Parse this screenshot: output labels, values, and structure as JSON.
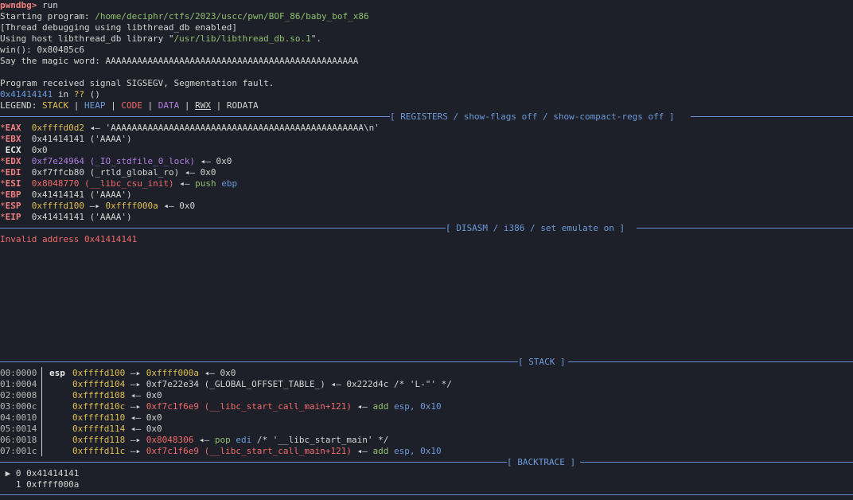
{
  "header": {
    "prompt": "pwndbg>",
    "command": " run",
    "starting_label": "Starting program: ",
    "program_path": "/home/deciphr/ctfs/2023/uscc/pwn/BOF_86/baby_bof_x86",
    "thread_debug": "[Thread debugging using libthread_db enabled]",
    "libthread_label": "Using host libthread_db library \"",
    "libthread_path": "/usr/lib/libthread_db.so.1",
    "libthread_end": "\".",
    "win_line": "win(): 0x80485c6",
    "magic_line": "Say the magic word: AAAAAAAAAAAAAAAAAAAAAAAAAAAAAAAAAAAAAAAAAAAAAAAA",
    "signal_line": "Program received signal SIGSEGV, Segmentation fault.",
    "fault_addr": "0x41414141",
    "fault_in": " in ",
    "fault_q": "??",
    "fault_paren": " ()"
  },
  "legend": {
    "label": "LEGEND: ",
    "stack": "STACK",
    "heap": "HEAP",
    "code": "CODE",
    "data": "DATA",
    "rwx": "RWX",
    "rodata": "RODATA",
    "pipe": " | "
  },
  "sections": {
    "registers": "[ REGISTERS / show-flags off / show-compact-regs off ]",
    "disasm": "[ DISASM / i386 / set emulate on ]",
    "stack": "[ STACK ]",
    "backtrace": "[ BACKTRACE ]"
  },
  "registers": [
    {
      "star": "*",
      "name": "EAX",
      "value": "0xffffd0d2",
      "rest": " ◂— 'AAAAAAAAAAAAAAAAAAAAAAAAAAAAAAAAAAAAAAAAAAAAAAAA\\n'"
    },
    {
      "star": "*",
      "name": "EBX",
      "value": "0x41414141",
      "rest": " ('AAAA')"
    },
    {
      "star": " ",
      "name": "ECX",
      "value": "0x0",
      "rest": ""
    },
    {
      "star": "*",
      "name": "EDX",
      "value": "0xf7e24964",
      "sym": " (_IO_stdfile_0_lock)",
      "rest": " ◂— 0x0"
    },
    {
      "star": "*",
      "name": "EDI",
      "value": "0xf7ffcb80",
      "rest": " (_rtld_global_ro) ◂— 0x0"
    },
    {
      "star": "*",
      "name": "ESI",
      "value": "0x8048770",
      "sym": " (__libc_csu_init)",
      "rest": " ◂— ",
      "op": "push",
      "arg": " ebp"
    },
    {
      "star": "*",
      "name": "EBP",
      "value": "0x41414141",
      "rest": " ('AAAA')"
    },
    {
      "star": "*",
      "name": "ESP",
      "value": "0xffffd100",
      "arrow": " —▸ ",
      "value2": "0xffff000a",
      "rest": " ◂— 0x0"
    },
    {
      "star": "*",
      "name": "EIP",
      "value": "0x41414141",
      "rest": " ('AAAA')"
    }
  ],
  "disasm": {
    "invalid": "Invalid address 0x41414141"
  },
  "stack": [
    {
      "idx": "00:0000",
      "reg": "esp",
      "addr": "0xffffd100",
      "arrow": " —▸ ",
      "ptr": "0xffff000a",
      "ptr_color": "#e0c050",
      "tail": " ◂— 0x0"
    },
    {
      "idx": "01:0004",
      "reg": "",
      "addr": "0xffffd104",
      "arrow": " —▸ ",
      "ptr": "0xf7e22e34 (_GLOBAL_OFFSET_TABLE_)",
      "ptr_color": "#d4d4d4",
      "tail": " ◂— 0x222d4c /* 'L-\"' */"
    },
    {
      "idx": "02:0008",
      "reg": "",
      "addr": "0xffffd108",
      "arrow": "",
      "ptr": "",
      "ptr_color": "#d4d4d4",
      "tail": " ◂— 0x0"
    },
    {
      "idx": "03:000c",
      "reg": "",
      "addr": "0xffffd10c",
      "arrow": " —▸ ",
      "ptr": "0xf7c1f6e9 (__libc_start_call_main+121)",
      "ptr_color": "#f06a6a",
      "tail": " ◂— ",
      "op": "add",
      "arg1": " esp",
      "arg2": ", 0x10"
    },
    {
      "idx": "04:0010",
      "reg": "",
      "addr": "0xffffd110",
      "arrow": "",
      "ptr": "",
      "ptr_color": "#d4d4d4",
      "tail": " ◂— 0x0"
    },
    {
      "idx": "05:0014",
      "reg": "",
      "addr": "0xffffd114",
      "arrow": "",
      "ptr": "",
      "ptr_color": "#d4d4d4",
      "tail": " ◂— 0x0"
    },
    {
      "idx": "06:0018",
      "reg": "",
      "addr": "0xffffd118",
      "arrow": " —▸ ",
      "ptr": "0x8048306",
      "ptr_color": "#f06a6a",
      "tail": " ◂— ",
      "op": "pop",
      "arg1": " edi",
      "arg2": " /* '__libc_start_main' */"
    },
    {
      "idx": "07:001c",
      "reg": "",
      "addr": "0xffffd11c",
      "arrow": " —▸ ",
      "ptr": "0xf7c1f6e9 (__libc_start_call_main+121)",
      "ptr_color": "#f06a6a",
      "tail": " ◂— ",
      "op": "add",
      "arg1": " esp",
      "arg2": ", 0x10"
    }
  ],
  "backtrace": [
    {
      "marker": " ▶ ",
      "frame": "0 0x41414141"
    },
    {
      "marker": "   ",
      "frame": "1 0xffff000a"
    }
  ]
}
